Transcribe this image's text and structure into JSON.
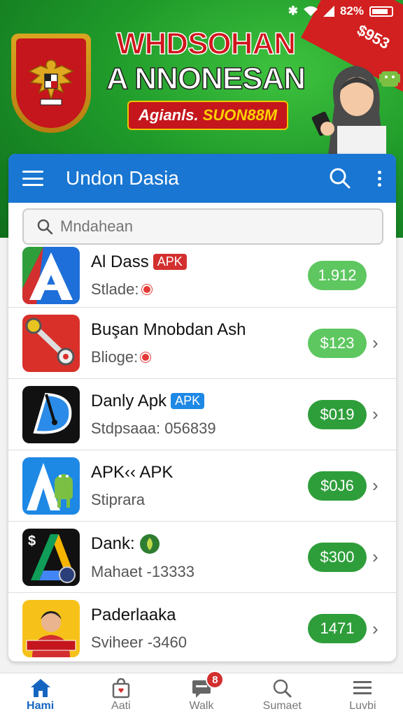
{
  "status_bar": {
    "battery_text": "82%"
  },
  "banner": {
    "headline_line1": "WHDSOHAN",
    "headline_line2": "A NNONESAN",
    "subtitle_part1": "Agianls.",
    "subtitle_part2": "SUON88M",
    "corner_text": "$953"
  },
  "appbar": {
    "title": "Undon Dasia"
  },
  "search": {
    "placeholder": "Mndahean"
  },
  "apps": [
    {
      "title": "Al Dass",
      "badge": "APK",
      "badge_color": "red",
      "subtitle": "Stlade:",
      "sub_dot": true,
      "price": "1.912",
      "price_style": "light",
      "chevron": false,
      "icon": "a-letter-icon"
    },
    {
      "title": "Buşan Mnobdan Ash",
      "badge": "",
      "badge_color": "",
      "subtitle": "Blioge:",
      "sub_dot": true,
      "price": "$123",
      "price_style": "light",
      "chevron": true,
      "icon": "wrench-icon"
    },
    {
      "title": "Danly Apk",
      "badge": "APK",
      "badge_color": "blue",
      "subtitle": "Stdpsaaa: 056839",
      "sub_dot": false,
      "price": "$019",
      "price_style": "dark",
      "chevron": true,
      "icon": "d-logo-icon"
    },
    {
      "title": "APK‹‹ APK",
      "badge": "",
      "badge_color": "",
      "subtitle": "Stiprara",
      "sub_dot": false,
      "price": "$0J6",
      "price_style": "dark",
      "chevron": true,
      "icon": "android-a-icon"
    },
    {
      "title": "Dank:",
      "badge": "",
      "badge_color": "",
      "subtitle": "Mahaet -13333",
      "sub_dot": false,
      "price": "$300",
      "price_style": "dark",
      "chevron": true,
      "icon": "drive-a-icon"
    },
    {
      "title": "Paderlaaka",
      "badge": "",
      "badge_color": "",
      "subtitle": "Sviheer -3460",
      "sub_dot": false,
      "price": "1471",
      "price_style": "dark",
      "chevron": true,
      "icon": "portrait-icon"
    }
  ],
  "bottom_nav": [
    {
      "label": "Hami",
      "icon": "home-icon",
      "active": true
    },
    {
      "label": "Aati",
      "icon": "bag-icon",
      "active": false
    },
    {
      "label": "Walk",
      "icon": "chat-icon",
      "active": false,
      "badge": "8"
    },
    {
      "label": "Sumaet",
      "icon": "search-icon",
      "active": false
    },
    {
      "label": "Luvbi",
      "icon": "menu-icon",
      "active": false
    }
  ],
  "colors": {
    "primary": "#1976d2",
    "green": "#2e9e3a",
    "light_green": "#5ec760",
    "red": "#d32f2f"
  }
}
